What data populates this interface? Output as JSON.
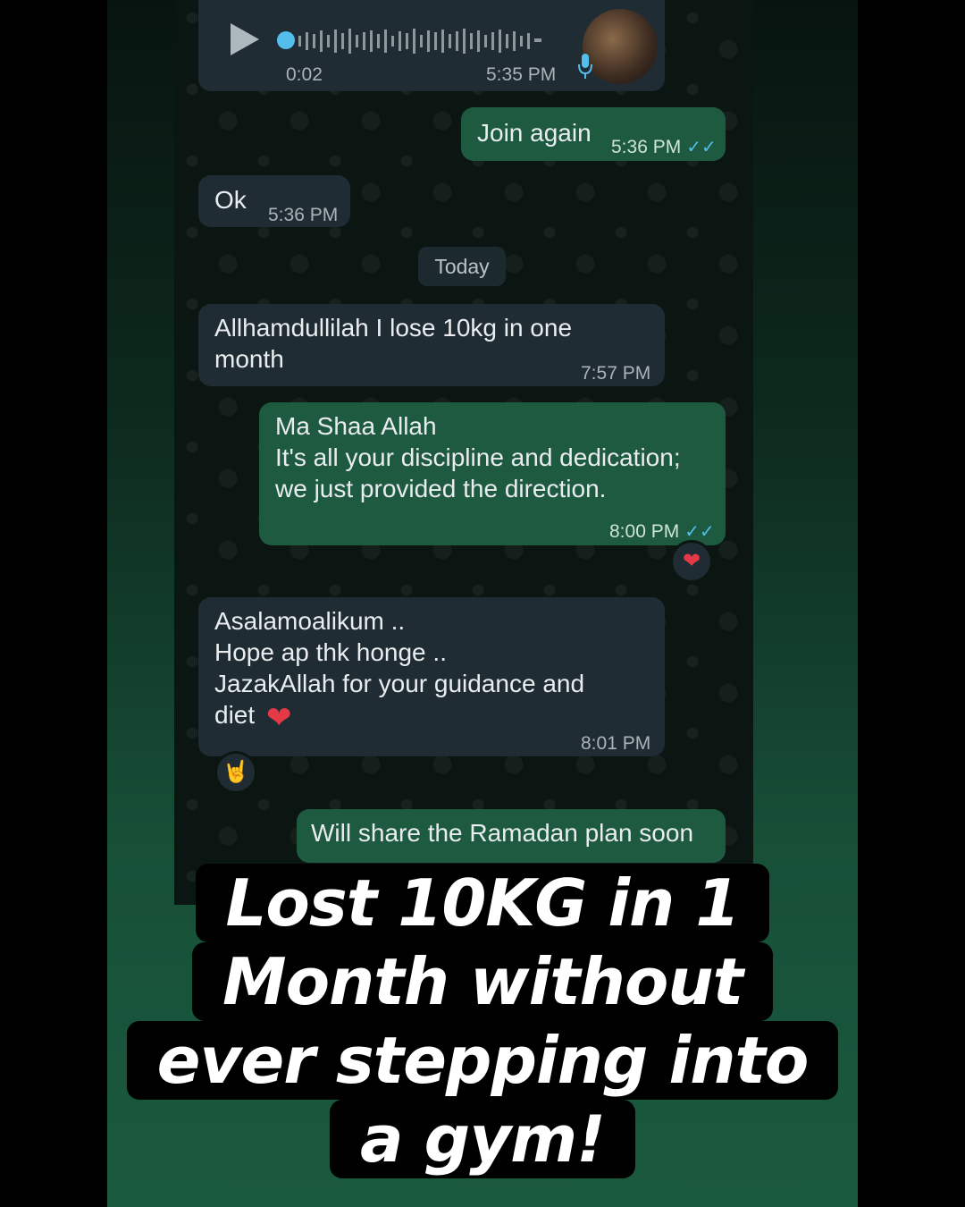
{
  "chat": {
    "voice_note": {
      "duration": "0:02",
      "time": "5:35 PM"
    },
    "messages": [
      {
        "text": "Join again",
        "time": "5:36 PM"
      },
      {
        "text": "Ok",
        "time": "5:36 PM"
      },
      {
        "text": "Allhamdullilah I lose 10kg in one\nmonth",
        "time": "7:57 PM"
      },
      {
        "text": "Ma Shaa Allah\nIt's all your discipline and dedication;\nwe just provided the direction.",
        "time": "8:00 PM"
      },
      {
        "text": "Asalamoalikum ..\nHope ap thk honge ..\nJazakAllah for your guidance and\ndiet",
        "time": "8:01 PM"
      },
      {
        "text": "Will share the Ramadan plan soon"
      }
    ],
    "date_divider": "Today",
    "reactions": [
      "heart-emoji",
      "rock-on-hand-emoji"
    ]
  },
  "caption": {
    "lines": [
      "Lost 10KG in 1",
      "Month without",
      "ever stepping into",
      "a gym!"
    ]
  },
  "colors": {
    "incoming_bubble": "#202c33",
    "outgoing_bubble": "#1d5a40",
    "read_ticks": "#53bdeb",
    "background_green": "#1a5a3f"
  }
}
